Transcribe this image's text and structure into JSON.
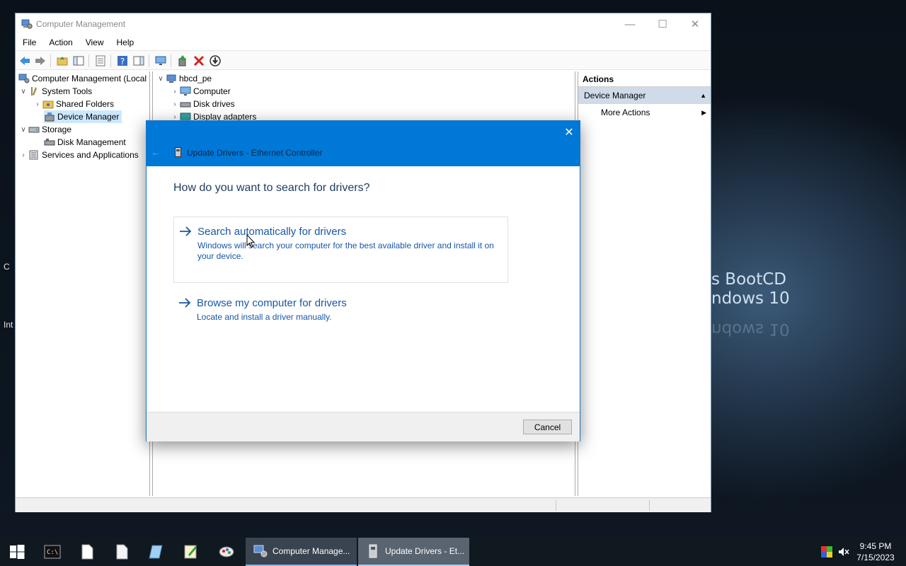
{
  "desktop": {
    "wallpaper_line1": "s BootCD",
    "wallpaper_line2": "ndows 10",
    "wallpaper_line3": "ndows 10",
    "icon_label_1": "C",
    "icon_label_2": "Int"
  },
  "window": {
    "title": "Computer Management",
    "menu": [
      "File",
      "Action",
      "View",
      "Help"
    ]
  },
  "tree": {
    "root": "Computer Management (Local",
    "items": [
      {
        "label": "System Tools",
        "icon": "tools-icon"
      },
      {
        "label": "Shared Folders",
        "icon": "shared-folder-icon"
      },
      {
        "label": "Device Manager",
        "icon": "device-manager-icon"
      },
      {
        "label": "Storage",
        "icon": "storage-icon"
      },
      {
        "label": "Disk Management",
        "icon": "disk-icon"
      },
      {
        "label": "Services and Applications",
        "icon": "services-icon"
      }
    ]
  },
  "devices": {
    "root": "hbcd_pe",
    "items": [
      "Computer",
      "Disk drives",
      "Display adapters"
    ]
  },
  "actions": {
    "header": "Actions",
    "section": "Device Manager",
    "item": "More Actions"
  },
  "dialog": {
    "title": "Update Drivers - Ethernet Controller",
    "question": "How do you want to search for drivers?",
    "option1_title": "Search automatically for drivers",
    "option1_desc": "Windows will search your computer for the best available driver and install it on your device.",
    "option2_title": "Browse my computer for drivers",
    "option2_desc": "Locate and install a driver manually.",
    "cancel_label": "Cancel"
  },
  "taskbar": {
    "buttons": [
      "Computer Manage...",
      "Update Drivers - Et..."
    ],
    "time": "9:45 PM",
    "date": "7/15/2023"
  },
  "colors": {
    "accent": "#0078d7",
    "link": "#1757a8",
    "selection": "#cce8ff"
  }
}
